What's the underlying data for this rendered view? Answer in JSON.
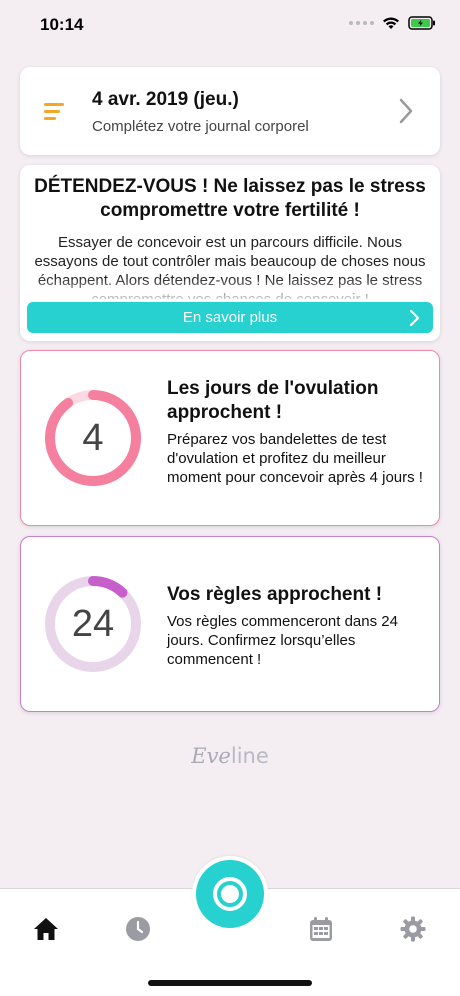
{
  "status_bar": {
    "time": "10:14"
  },
  "journal": {
    "date": "4 avr. 2019 (jeu.)",
    "subtitle": "Complétez votre journal corporel"
  },
  "article": {
    "title": "DÉTENDEZ-VOUS ! Ne laissez pas le stress compromettre votre fertilité !",
    "body": "Essayer de concevoir est un parcours difficile. Nous essayons de tout contrôler mais beaucoup de choses nous échappent. Alors détendez-vous ! Ne laissez pas le stress compromettre vos chances de concevoir !",
    "button_label": "En savoir plus"
  },
  "ovulation": {
    "days": "4",
    "progress": 0.9,
    "title": "Les jours de l'ovulation approchent !",
    "text": "Préparez vos bandelettes de test d'ovulation et profitez du meilleur moment pour concevoir après 4 jours !",
    "color": "#f47f9f",
    "track_color": "#fbd9e3"
  },
  "period": {
    "days": "24",
    "progress": 0.12,
    "title": "Vos règles approchent !",
    "text": "Vos règles commenceront dans 24 jours. Confirmez lorsqu’elles commencent !",
    "color": "#c65fc9",
    "track_color": "#e8d5e9"
  },
  "brand": {
    "logo_bold": "Eve",
    "logo_light": "line"
  },
  "tabbar": {
    "items": [
      {
        "icon": "home-icon",
        "active": true
      },
      {
        "icon": "clock-icon",
        "active": false
      },
      {
        "icon": "record-icon",
        "active": false
      },
      {
        "icon": "calendar-icon",
        "active": false
      },
      {
        "icon": "gear-icon",
        "active": false
      }
    ]
  },
  "colors": {
    "accent": "#26d1cf",
    "menu_icon": "#f5a623",
    "background": "#f4eef3"
  }
}
